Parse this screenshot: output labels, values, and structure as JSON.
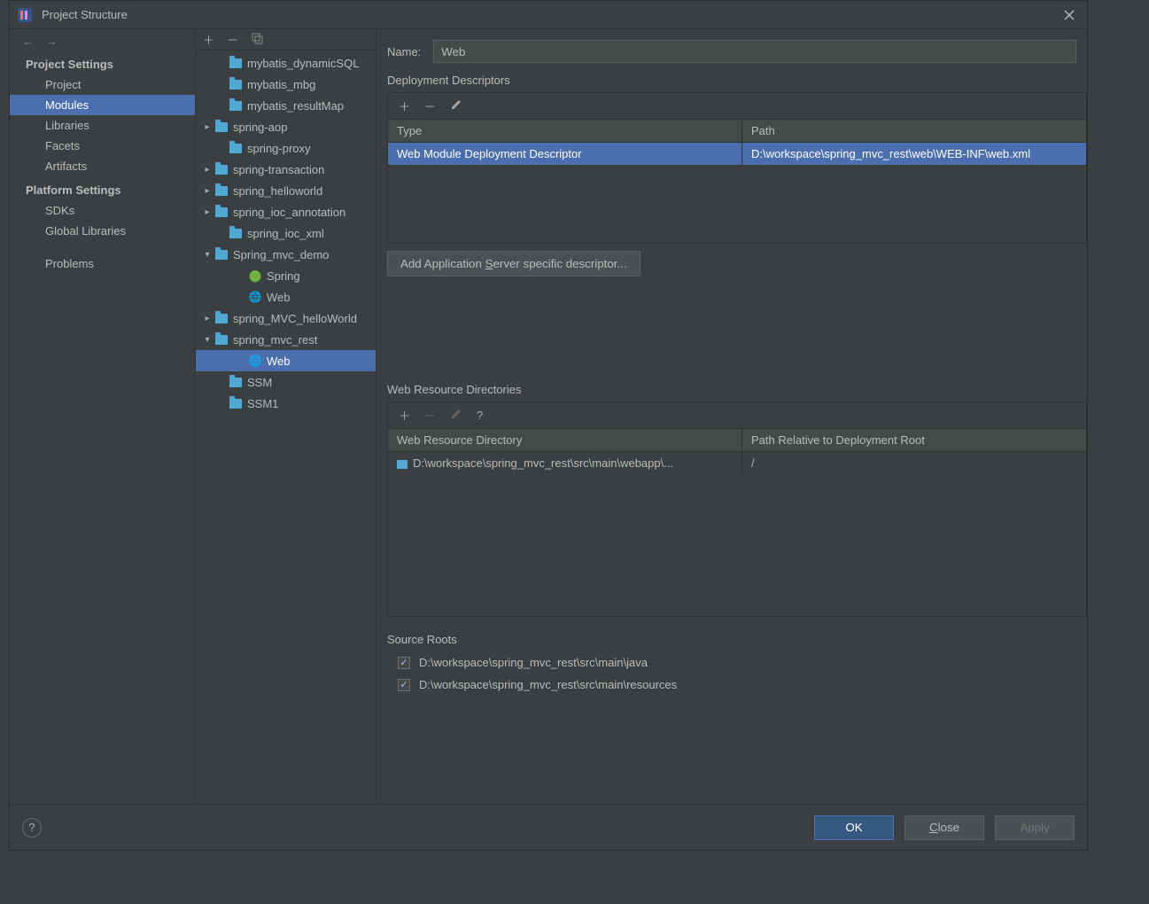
{
  "title": "Project Structure",
  "sidebar": {
    "section1": "Project Settings",
    "items1": [
      "Project",
      "Modules",
      "Libraries",
      "Facets",
      "Artifacts"
    ],
    "section2": "Platform Settings",
    "items2": [
      "SDKs",
      "Global Libraries"
    ],
    "problems": "Problems"
  },
  "tree": [
    {
      "indent": 1,
      "chev": "",
      "icon": "folder",
      "label": "mybatis_dynamicSQL"
    },
    {
      "indent": 1,
      "chev": "",
      "icon": "folder",
      "label": "mybatis_mbg"
    },
    {
      "indent": 1,
      "chev": "",
      "icon": "folder",
      "label": "mybatis_resultMap"
    },
    {
      "indent": 0,
      "chev": ">",
      "icon": "folder",
      "label": "spring-aop"
    },
    {
      "indent": 1,
      "chev": "",
      "icon": "folder",
      "label": "spring-proxy"
    },
    {
      "indent": 0,
      "chev": ">",
      "icon": "folder",
      "label": "spring-transaction"
    },
    {
      "indent": 0,
      "chev": ">",
      "icon": "folder",
      "label": "spring_helloworld"
    },
    {
      "indent": 0,
      "chev": ">",
      "icon": "folder",
      "label": "spring_ioc_annotation"
    },
    {
      "indent": 1,
      "chev": "",
      "icon": "folder",
      "label": "spring_ioc_xml"
    },
    {
      "indent": 0,
      "chev": "v",
      "icon": "folder",
      "label": "Spring_mvc_demo"
    },
    {
      "indent": 2,
      "chev": "",
      "icon": "spring",
      "label": "Spring"
    },
    {
      "indent": 2,
      "chev": "",
      "icon": "web",
      "label": "Web"
    },
    {
      "indent": 0,
      "chev": ">",
      "icon": "folder",
      "label": "spring_MVC_helloWorld"
    },
    {
      "indent": 0,
      "chev": "v",
      "icon": "folder",
      "label": "spring_mvc_rest"
    },
    {
      "indent": 2,
      "chev": "",
      "icon": "web",
      "label": "Web",
      "selected": true
    },
    {
      "indent": 1,
      "chev": "",
      "icon": "folder",
      "label": "SSM"
    },
    {
      "indent": 1,
      "chev": "",
      "icon": "folder",
      "label": "SSM1"
    }
  ],
  "main": {
    "name_label": "Name:",
    "name_value": "Web",
    "sect_dd": "Deployment Descriptors",
    "dd_headers": {
      "type": "Type",
      "path": "Path"
    },
    "dd_row": {
      "type": "Web Module Deployment Descriptor",
      "path": "D:\\workspace\\spring_mvc_rest\\web\\WEB-INF\\web.xml"
    },
    "add_server_btn": "Add Application Server specific descriptor...",
    "sect_wrd": "Web Resource Directories",
    "wrd_headers": {
      "dir": "Web Resource Directory",
      "rel": "Path Relative to Deployment Root"
    },
    "wrd_row": {
      "dir": "D:\\workspace\\spring_mvc_rest\\src\\main\\webapp\\...",
      "rel": "/"
    },
    "sect_sr": "Source Roots",
    "sr_items": [
      "D:\\workspace\\spring_mvc_rest\\src\\main\\java",
      "D:\\workspace\\spring_mvc_rest\\src\\main\\resources"
    ]
  },
  "footer": {
    "ok": "OK",
    "close": "Close",
    "apply": "Apply"
  }
}
